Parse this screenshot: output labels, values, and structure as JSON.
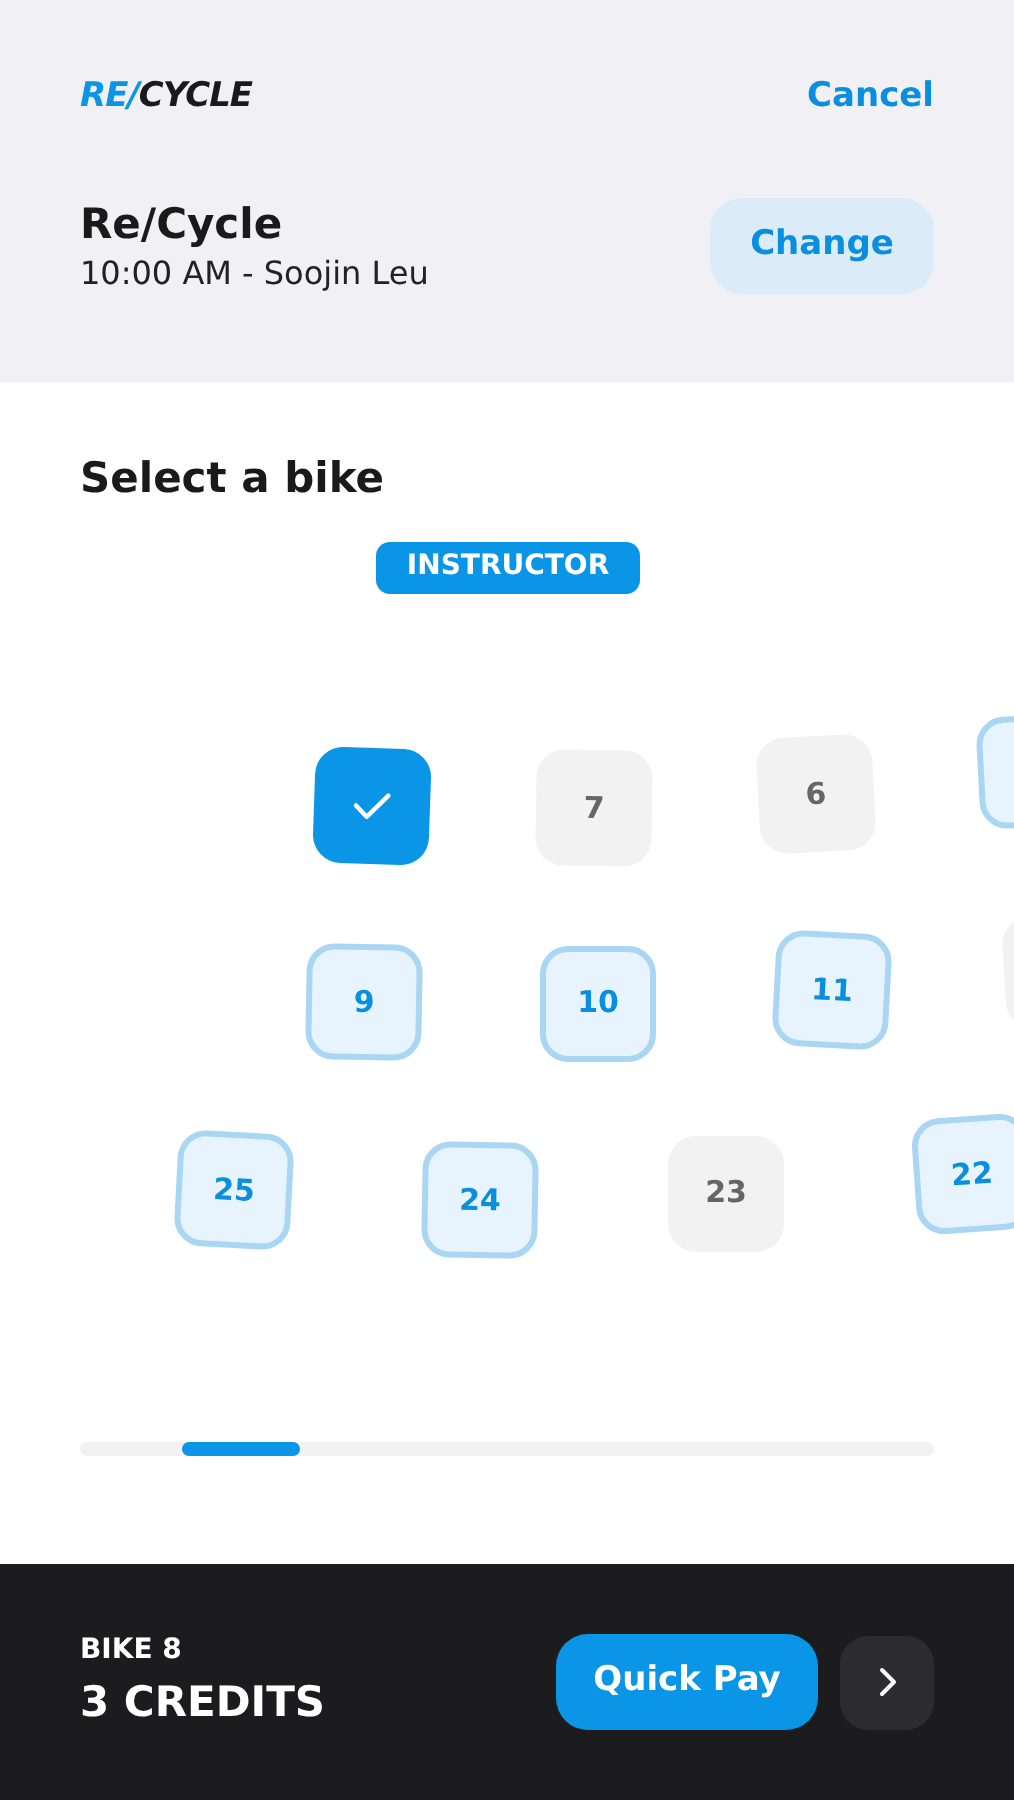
{
  "header": {
    "logo": {
      "accent": "RE/",
      "rest": "CYCLE"
    },
    "cancel": "Cancel"
  },
  "class_info": {
    "title": "Re/Cycle",
    "subtitle": "10:00 AM - Soojin Leu",
    "change": "Change"
  },
  "section_title": "Select a bike",
  "instructor_badge": "INSTRUCTOR",
  "bikes": [
    {
      "kind": "selected"
    },
    {
      "kind": "taken",
      "number": "7"
    },
    {
      "kind": "taken",
      "number": "6"
    },
    {
      "kind": "available"
    },
    {
      "kind": "available",
      "number": "9"
    },
    {
      "kind": "available",
      "number": "10"
    },
    {
      "kind": "available",
      "number": "11"
    },
    {
      "kind": "taken"
    },
    {
      "kind": "available",
      "number": "25"
    },
    {
      "kind": "available",
      "number": "24"
    },
    {
      "kind": "taken",
      "number": "23"
    },
    {
      "kind": "available",
      "number": "22"
    }
  ],
  "footer": {
    "bike": "BIKE 8",
    "credits": "3 CREDITS",
    "quick_pay": "Quick Pay"
  }
}
